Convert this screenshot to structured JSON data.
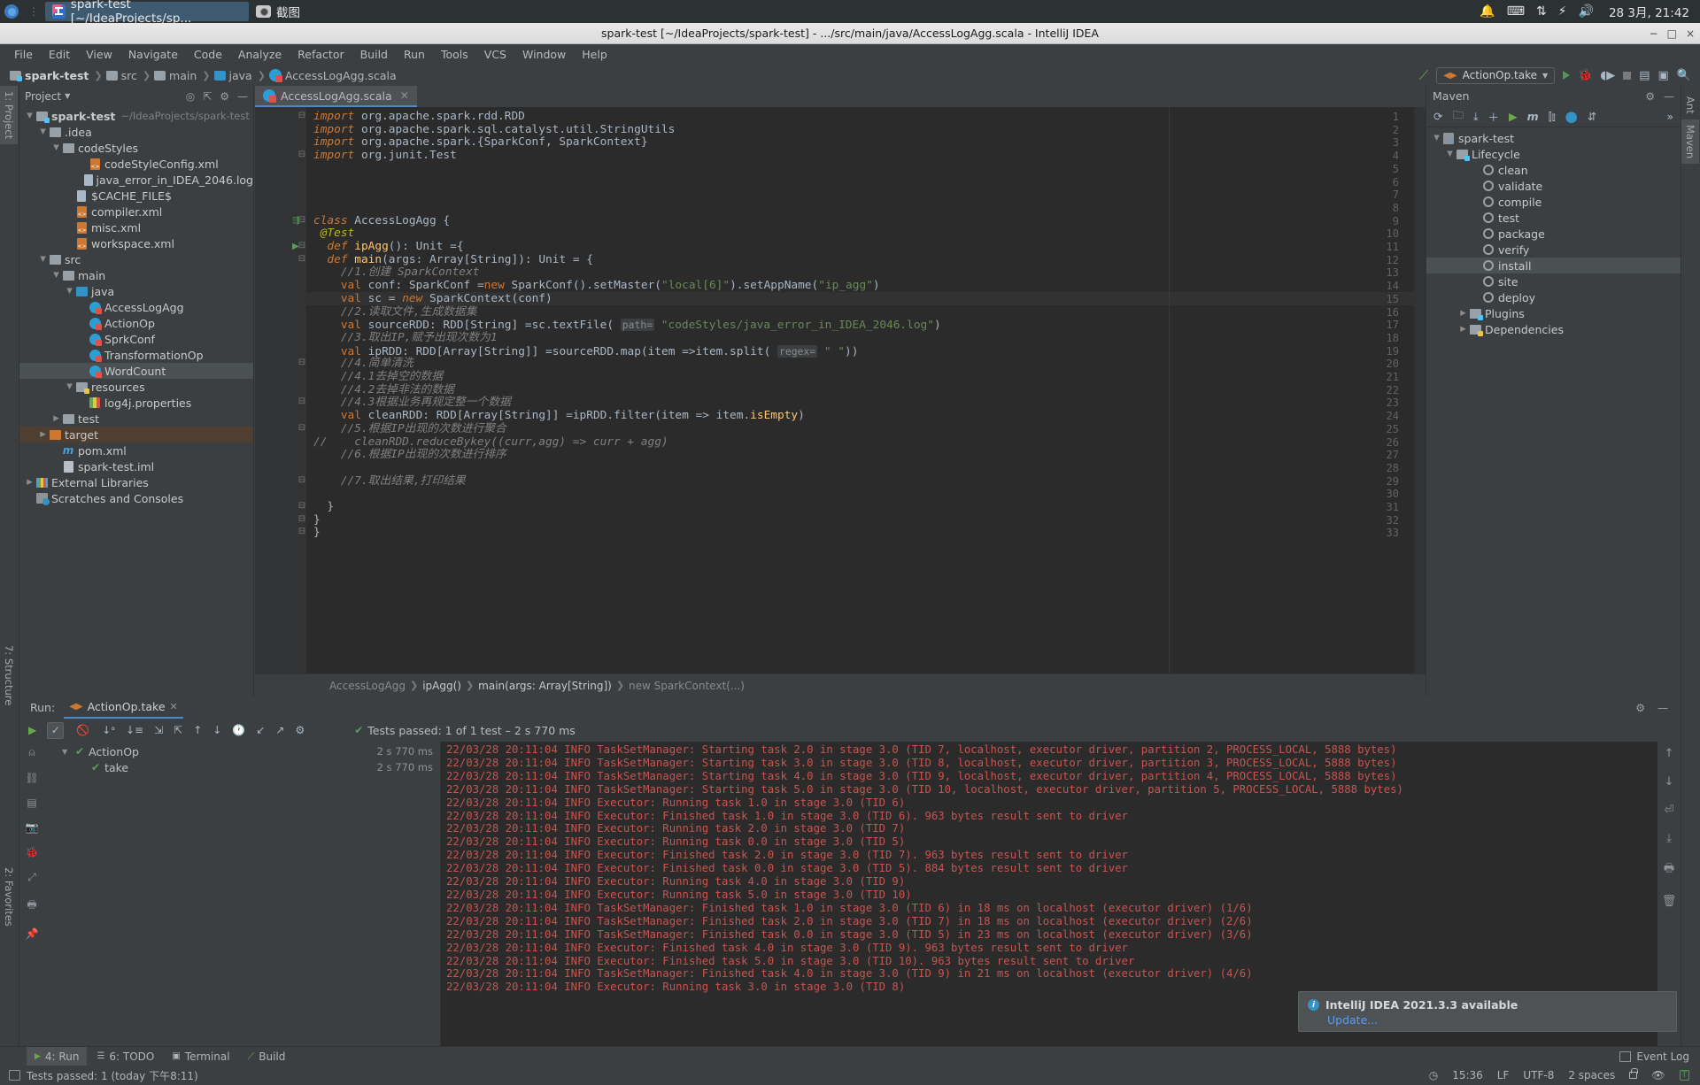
{
  "os_bar": {
    "window_buttons": [
      {
        "label": "spark-test [~/IdeaProjects/sp...",
        "icon": "intellij-icon",
        "active": true
      },
      {
        "label": "截图",
        "icon": "camera-icon",
        "active": false
      }
    ],
    "tray_icons": [
      "bell-icon",
      "keyboard-icon",
      "network-icon",
      "power-icon",
      "volume-icon"
    ],
    "clock": "28 3月, 21:42"
  },
  "title_bar": {
    "title": "spark-test [~/IdeaProjects/spark-test] - .../src/main/java/AccessLogAgg.scala - IntelliJ IDEA",
    "minimize": "−",
    "maximize": "□",
    "close": "×"
  },
  "menu": [
    "File",
    "Edit",
    "View",
    "Navigate",
    "Code",
    "Analyze",
    "Refactor",
    "Build",
    "Run",
    "Tools",
    "VCS",
    "Window",
    "Help"
  ],
  "navbar": {
    "crumbs": [
      {
        "label": "spark-test",
        "icon": "module-folder-icon"
      },
      {
        "label": "src",
        "icon": "folder-icon"
      },
      {
        "label": "main",
        "icon": "folder-icon"
      },
      {
        "label": "java",
        "icon": "source-folder-icon"
      },
      {
        "label": "AccessLogAgg.scala",
        "icon": "scala-file-icon"
      }
    ],
    "run_config": "ActionOp.take",
    "buttons": [
      "build-icon",
      "run-icon",
      "debug-icon",
      "run-coverage-icon",
      "stop-icon",
      "project-structure-icon",
      "updates-icon",
      "search-icon"
    ]
  },
  "left_rail": [
    {
      "label": "1: Project",
      "selected": true
    },
    {
      "label": "7: Structure",
      "selected": false
    },
    {
      "label": "2: Favorites",
      "selected": false
    }
  ],
  "right_rail": [
    {
      "label": "Ant",
      "selected": false
    },
    {
      "label": "Maven",
      "selected": true
    }
  ],
  "project_panel": {
    "title": "Project",
    "toolbar_icons": [
      "locate-icon",
      "collapse-all-icon",
      "settings-icon",
      "hide-icon"
    ],
    "tree": [
      {
        "depth": 0,
        "arrow": "▼",
        "icon": "module-folder-icon",
        "label": "spark-test",
        "sub": "~/IdeaProjects/spark-test",
        "bold": true
      },
      {
        "depth": 1,
        "arrow": "▼",
        "icon": "folder-icon",
        "label": ".idea"
      },
      {
        "depth": 2,
        "arrow": "▼",
        "icon": "folder-icon",
        "label": "codeStyles"
      },
      {
        "depth": 4,
        "arrow": "",
        "icon": "xml-file-icon",
        "label": "codeStyleConfig.xml"
      },
      {
        "depth": 4,
        "arrow": "",
        "icon": "log-file-icon",
        "label": "java_error_in_IDEA_2046.log"
      },
      {
        "depth": 3,
        "arrow": "",
        "icon": "log-file-icon",
        "label": "$CACHE_FILE$"
      },
      {
        "depth": 3,
        "arrow": "",
        "icon": "xml-file-icon",
        "label": "compiler.xml"
      },
      {
        "depth": 3,
        "arrow": "",
        "icon": "xml-file-icon",
        "label": "misc.xml"
      },
      {
        "depth": 3,
        "arrow": "",
        "icon": "xml-file-icon",
        "label": "workspace.xml"
      },
      {
        "depth": 1,
        "arrow": "▼",
        "icon": "folder-icon",
        "label": "src"
      },
      {
        "depth": 2,
        "arrow": "▼",
        "icon": "folder-icon",
        "label": "main"
      },
      {
        "depth": 3,
        "arrow": "▼",
        "icon": "source-folder-icon",
        "label": "java"
      },
      {
        "depth": 4,
        "arrow": "",
        "icon": "scala-file-icon",
        "label": "AccessLogAgg"
      },
      {
        "depth": 4,
        "arrow": "",
        "icon": "scala-file-icon",
        "label": "ActionOp"
      },
      {
        "depth": 4,
        "arrow": "",
        "icon": "scala-file-icon",
        "label": "SprkConf"
      },
      {
        "depth": 4,
        "arrow": "",
        "icon": "scala-file-icon",
        "label": "TransformationOp"
      },
      {
        "depth": 4,
        "arrow": "",
        "icon": "scala-file-icon",
        "label": "WordCount",
        "selected": true
      },
      {
        "depth": 3,
        "arrow": "▼",
        "icon": "resource-folder-icon",
        "label": "resources"
      },
      {
        "depth": 4,
        "arrow": "",
        "icon": "properties-file-icon",
        "label": "log4j.properties"
      },
      {
        "depth": 2,
        "arrow": "▶",
        "icon": "folder-icon",
        "label": "test"
      },
      {
        "depth": 1,
        "arrow": "▶",
        "icon": "excluded-folder-icon",
        "label": "target",
        "highlight": "brown"
      },
      {
        "depth": 2,
        "arrow": "",
        "icon": "maven-file-icon",
        "label": "pom.xml"
      },
      {
        "depth": 2,
        "arrow": "",
        "icon": "iml-file-icon",
        "label": "spark-test.iml"
      },
      {
        "depth": 0,
        "arrow": "▶",
        "icon": "library-icon",
        "label": "External Libraries"
      },
      {
        "depth": 0,
        "arrow": "",
        "icon": "scratches-icon",
        "label": "Scratches and Consoles"
      }
    ]
  },
  "editor": {
    "tab": "AccessLogAgg.scala",
    "tab_icon": "scala-file-icon",
    "cursor_line": 15,
    "lines": [
      {
        "n": 1,
        "fold": "⊟",
        "html": "<span class=\"kw\">import</span> org.apache.spark.rdd.<span class=\"ty\">RDD</span>"
      },
      {
        "n": 2,
        "fold": "",
        "html": "<span class=\"kw\">import</span> org.apache.spark.sql.catalyst.util.<span class=\"ty\">StringUtils</span>"
      },
      {
        "n": 3,
        "fold": "",
        "html": "<span class=\"kw\">import</span> org.apache.spark.{<span class=\"ty\">SparkConf</span>, <span class=\"ty\">SparkContext</span>}"
      },
      {
        "n": 4,
        "fold": "⊟",
        "html": "<span class=\"kw\">import</span> org.junit.<span class=\"ty\">Test</span>"
      },
      {
        "n": 5,
        "fold": "",
        "html": ""
      },
      {
        "n": 6,
        "fold": "",
        "html": ""
      },
      {
        "n": 7,
        "fold": "",
        "html": ""
      },
      {
        "n": 8,
        "fold": "",
        "html": ""
      },
      {
        "n": 9,
        "fold": "⊟",
        "html": "<span class=\"kw\">class</span> <span class=\"cls\">AccessLogAgg</span> {",
        "gutter": "run-class-icon"
      },
      {
        "n": 10,
        "fold": "",
        "html": " <span class=\"ann\">@Test</span>"
      },
      {
        "n": 11,
        "fold": "⊟",
        "html": "  <span class=\"kw\">def</span> <span class=\"fn\">ipAgg</span>(): <span class=\"ty\">Unit</span> ={",
        "gutter": "run-method-icon"
      },
      {
        "n": 12,
        "fold": "⊟",
        "html": "  <span class=\"kw\">def</span> <span class=\"fn\">main</span>(args: <span class=\"ty\">Array</span>[<span class=\"ty\">String</span>]): <span class=\"ty\">Unit</span> = {"
      },
      {
        "n": 13,
        "fold": "",
        "html": "    <span class=\"cm\">//1.创建 SparkContext</span>"
      },
      {
        "n": 14,
        "fold": "",
        "html": "    <span class=\"k\">val</span> conf: <span class=\"ty\">SparkConf</span> =<span class=\"k\">new</span> <span class=\"ty\">SparkConf</span>().setMaster(<span class=\"s\">\"local[6]\"</span>).setAppName(<span class=\"s\">\"ip_agg\"</span>)"
      },
      {
        "n": 15,
        "fold": "",
        "html": "    <span class=\"k\">val</span> sc = <span class=\"kw\">new</span> <span class=\"ty\">SparkContext</span>(conf)"
      },
      {
        "n": 16,
        "fold": "",
        "html": "    <span class=\"cm\">//2.读取文件,生成数据集</span>"
      },
      {
        "n": 17,
        "fold": "",
        "html": "    <span class=\"k\">val</span> sourceRDD: <span class=\"ty\">RDD</span>[<span class=\"ty\">String</span>] =sc.textFile( <span class=\"hint\">path=</span> <span class=\"s\">\"codeStyles/java_error_in_IDEA_2046.log\"</span>)"
      },
      {
        "n": 18,
        "fold": "",
        "html": "    <span class=\"cm\">//3.取出IP,赋予出现次数为1</span>"
      },
      {
        "n": 19,
        "fold": "",
        "html": "    <span class=\"k\">val</span> ipRDD: <span class=\"ty\">RDD</span>[<span class=\"ty\">Array</span>[<span class=\"ty\">String</span>]] =sourceRDD.map(item =&gt;item.split( <span class=\"hint\">regex=</span> <span class=\"s\">\" \"</span>))"
      },
      {
        "n": 20,
        "fold": "⊟",
        "html": "    <span class=\"cm\">//4.简单清洗</span>"
      },
      {
        "n": 21,
        "fold": "",
        "html": "    <span class=\"cm\">//4.1去掉空的数据</span>"
      },
      {
        "n": 22,
        "fold": "",
        "html": "    <span class=\"cm\">//4.2去掉非法的数据</span>"
      },
      {
        "n": 23,
        "fold": "⊟",
        "html": "    <span class=\"cm\">//4.3根据业务再规定整一个数据</span>"
      },
      {
        "n": 24,
        "fold": "",
        "html": "    <span class=\"k\">val</span> cleanRDD: <span class=\"ty\">RDD</span>[<span class=\"ty\">Array</span>[<span class=\"ty\">String</span>]] =ipRDD.filter(item =&gt; item.<span class=\"fn\">isEmpty</span>)"
      },
      {
        "n": 25,
        "fold": "⊟",
        "html": "    <span class=\"cm\">//5.根据IP出现的次数进行聚合</span>"
      },
      {
        "n": 26,
        "fold": "",
        "html": "<span class=\"cm\">//    cleanRDD.reduceBykey((curr,agg) =&gt; curr + agg)</span>",
        "comment_prefix": true
      },
      {
        "n": 27,
        "fold": "",
        "html": "    <span class=\"cm\">//6.根据IP出现的次数进行排序</span>"
      },
      {
        "n": 28,
        "fold": "",
        "html": ""
      },
      {
        "n": 29,
        "fold": "⊟",
        "html": "    <span class=\"cm\">//7.取出结果,打印结果</span>"
      },
      {
        "n": 30,
        "fold": "",
        "html": ""
      },
      {
        "n": 31,
        "fold": "⊟",
        "html": "  }"
      },
      {
        "n": 32,
        "fold": "⊟",
        "html": "}"
      },
      {
        "n": 33,
        "fold": "⊟",
        "html": "}"
      }
    ],
    "breadcrumb": [
      "AccessLogAgg",
      "ipAgg()",
      "main(args: Array[String])",
      "new SparkContext(...)"
    ]
  },
  "maven_panel": {
    "title": "Maven",
    "toolbar_icons": [
      "reload-icon",
      "add-module-icon",
      "download-sources-icon",
      "add-icon",
      "run-goal-icon",
      "execute-maven-goal-icon",
      "toggle-skip-tests-icon",
      "toggle-offline-icon",
      "collapse-all-icon",
      "more-icon"
    ],
    "tree": [
      {
        "depth": 0,
        "arrow": "▼",
        "icon": "maven-project-icon",
        "label": "spark-test"
      },
      {
        "depth": 1,
        "arrow": "▼",
        "icon": "lifecycle-folder-icon",
        "label": "Lifecycle"
      },
      {
        "depth": 3,
        "arrow": "",
        "icon": "goal-icon",
        "label": "clean"
      },
      {
        "depth": 3,
        "arrow": "",
        "icon": "goal-icon",
        "label": "validate"
      },
      {
        "depth": 3,
        "arrow": "",
        "icon": "goal-icon",
        "label": "compile"
      },
      {
        "depth": 3,
        "arrow": "",
        "icon": "goal-icon",
        "label": "test"
      },
      {
        "depth": 3,
        "arrow": "",
        "icon": "goal-icon",
        "label": "package"
      },
      {
        "depth": 3,
        "arrow": "",
        "icon": "goal-icon",
        "label": "verify"
      },
      {
        "depth": 3,
        "arrow": "",
        "icon": "goal-icon",
        "label": "install",
        "selected": true
      },
      {
        "depth": 3,
        "arrow": "",
        "icon": "goal-icon",
        "label": "site"
      },
      {
        "depth": 3,
        "arrow": "",
        "icon": "goal-icon",
        "label": "deploy"
      },
      {
        "depth": 2,
        "arrow": "▶",
        "icon": "plugins-folder-icon",
        "label": "Plugins"
      },
      {
        "depth": 2,
        "arrow": "▶",
        "icon": "dependencies-folder-icon",
        "label": "Dependencies"
      }
    ]
  },
  "run_panel": {
    "label": "Run:",
    "tab": "ActionOp.take",
    "tab_icon": "scala-test-icon",
    "toolbar_icons": [
      "rerun-icon",
      "show-passed-icon",
      "show-ignored-icon",
      "sort-alphabetically-icon",
      "sort-by-duration-icon",
      "expand-all-icon",
      "collapse-all-icon",
      "prev-test-icon",
      "next-test-icon",
      "history-icon",
      "import-tests-icon",
      "export-tests-icon",
      "settings-icon"
    ],
    "status": "Tests passed: 1 of 1 test – 2 s 770 ms",
    "tests": [
      {
        "depth": 0,
        "arrow": "▼",
        "label": "ActionOp",
        "duration": "2 s 770 ms"
      },
      {
        "depth": 1,
        "arrow": "",
        "label": "take",
        "duration": "2 s 770 ms"
      }
    ],
    "console": [
      "22/03/28 20:11:04 INFO TaskSetManager: Starting task 2.0 in stage 3.0 (TID 7, localhost, executor driver, partition 2, PROCESS_LOCAL, 5888 bytes)",
      "22/03/28 20:11:04 INFO TaskSetManager: Starting task 3.0 in stage 3.0 (TID 8, localhost, executor driver, partition 3, PROCESS_LOCAL, 5888 bytes)",
      "22/03/28 20:11:04 INFO TaskSetManager: Starting task 4.0 in stage 3.0 (TID 9, localhost, executor driver, partition 4, PROCESS_LOCAL, 5888 bytes)",
      "22/03/28 20:11:04 INFO TaskSetManager: Starting task 5.0 in stage 3.0 (TID 10, localhost, executor driver, partition 5, PROCESS_LOCAL, 5888 bytes)",
      "22/03/28 20:11:04 INFO Executor: Running task 1.0 in stage 3.0 (TID 6)",
      "22/03/28 20:11:04 INFO Executor: Finished task 1.0 in stage 3.0 (TID 6). 963 bytes result sent to driver",
      "22/03/28 20:11:04 INFO Executor: Running task 2.0 in stage 3.0 (TID 7)",
      "22/03/28 20:11:04 INFO Executor: Running task 0.0 in stage 3.0 (TID 5)",
      "22/03/28 20:11:04 INFO Executor: Finished task 2.0 in stage 3.0 (TID 7). 963 bytes result sent to driver",
      "22/03/28 20:11:04 INFO Executor: Finished task 0.0 in stage 3.0 (TID 5). 884 bytes result sent to driver",
      "22/03/28 20:11:04 INFO Executor: Running task 4.0 in stage 3.0 (TID 9)",
      "22/03/28 20:11:04 INFO Executor: Running task 5.0 in stage 3.0 (TID 10)",
      "22/03/28 20:11:04 INFO TaskSetManager: Finished task 1.0 in stage 3.0 (TID 6) in 18 ms on localhost (executor driver) (1/6)",
      "22/03/28 20:11:04 INFO TaskSetManager: Finished task 2.0 in stage 3.0 (TID 7) in 18 ms on localhost (executor driver) (2/6)",
      "22/03/28 20:11:04 INFO TaskSetManager: Finished task 0.0 in stage 3.0 (TID 5) in 23 ms on localhost (executor driver) (3/6)",
      "22/03/28 20:11:04 INFO Executor: Finished task 4.0 in stage 3.0 (TID 9). 963 bytes result sent to driver",
      "22/03/28 20:11:04 INFO Executor: Finished task 5.0 in stage 3.0 (TID 10). 963 bytes result sent to driver",
      "22/03/28 20:11:04 INFO TaskSetManager: Finished task 4.0 in stage 3.0 (TID 9) in 21 ms on localhost (executor driver) (4/6)",
      "22/03/28 20:11:04 INFO Executor: Running task 3.0 in stage 3.0 (TID 8)"
    ]
  },
  "notification": {
    "title": "IntelliJ IDEA 2021.3.3 available",
    "action": "Update..."
  },
  "toolwindow_bar": [
    {
      "label": "4: Run",
      "icon": "run-icon",
      "selected": true,
      "mnemonic": "4"
    },
    {
      "label": "6: TODO",
      "icon": "todo-icon",
      "selected": false,
      "mnemonic": "6"
    },
    {
      "label": "Terminal",
      "icon": "terminal-icon",
      "selected": false
    },
    {
      "label": "Build",
      "icon": "build-icon",
      "selected": false
    }
  ],
  "event_log": "Event Log",
  "status_bar": {
    "message": "Tests passed: 1 (today 下午8:11)",
    "time": "15:36",
    "line_separator": "LF",
    "encoding": "UTF-8",
    "indent": "2 spaces",
    "icons": [
      "lock-icon",
      "inspections-icon",
      "translate-icon"
    ]
  },
  "colors": {
    "accent_blue": "#4a88c7",
    "panel_bg": "#3c3f41",
    "editor_bg": "#2b2b2b",
    "log_red": "#c75450",
    "pass_green": "#5a9e5a"
  }
}
